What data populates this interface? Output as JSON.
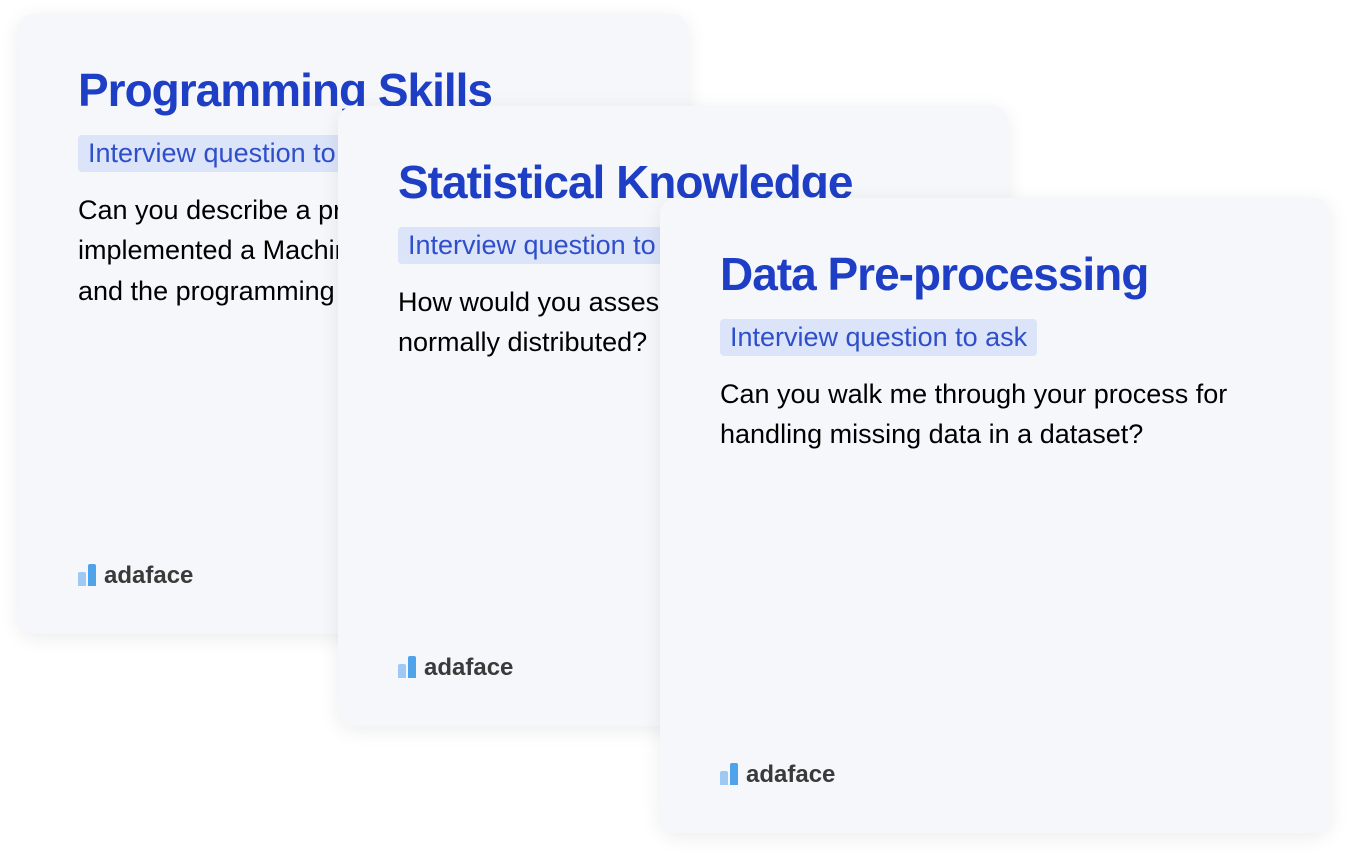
{
  "cards": [
    {
      "title": "Programming Skills",
      "badge": "Interview question to ask",
      "body": "Can you describe a project where you implemented a Machine Learning algorithm and the programming challenges you faced?"
    },
    {
      "title": "Statistical Knowledge",
      "badge": "Interview question to ask",
      "body": "How would you assess if a dataset is normally distributed?"
    },
    {
      "title": "Data Pre-processing",
      "badge": "Interview question to ask",
      "body": "Can you walk me through your process for handling missing data in a dataset?"
    }
  ],
  "brand": "adaface"
}
